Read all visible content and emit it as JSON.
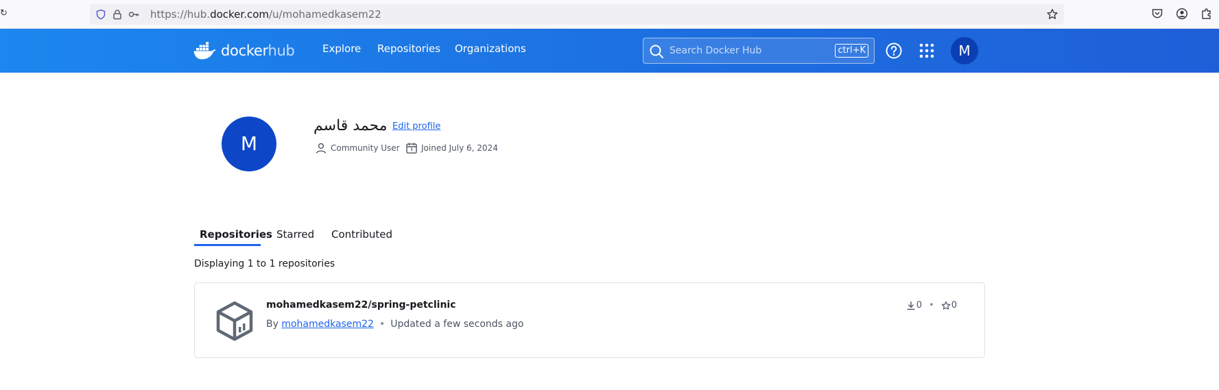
{
  "browser": {
    "url_prefix": "https://hub.",
    "url_domain": "docker.com",
    "url_path": "/u/mohamedkasem22"
  },
  "header": {
    "logo_word": "docker",
    "logo_hub": "hub",
    "nav": [
      "Explore",
      "Repositories",
      "Organizations"
    ],
    "search_placeholder": "Search Docker Hub",
    "search_shortcut": "ctrl+K",
    "avatar_initial": "M",
    "colors": {
      "gradient_start": "#1c87ee",
      "gradient_end": "#1e5fd8",
      "avatar": "#0b3fb3"
    }
  },
  "profile": {
    "avatar_initial": "M",
    "name": "محمد قاسم",
    "edit_label": "Edit profile",
    "role": "Community User",
    "joined": "Joined July 6, 2024"
  },
  "tabs": {
    "items": [
      "Repositories",
      "Starred",
      "Contributed"
    ],
    "active": "Repositories"
  },
  "listing": {
    "count_text": "Displaying 1 to 1 repositories"
  },
  "repositories": [
    {
      "name": "mohamedkasem22/spring-petclinic",
      "by_label": "By",
      "owner": "mohamedkasem22",
      "updated": "Updated a few seconds ago",
      "pulls": "0",
      "stars": "0"
    }
  ],
  "icons": [
    "shield-icon",
    "lock-icon",
    "key-icon",
    "bookmark-star-icon",
    "pocket-icon",
    "account-icon",
    "extensions-icon",
    "docker-whale-icon",
    "search-icon",
    "help-icon",
    "apps-grid-icon",
    "user-icon",
    "calendar-icon",
    "repository-box-icon",
    "download-icon",
    "star-icon"
  ]
}
